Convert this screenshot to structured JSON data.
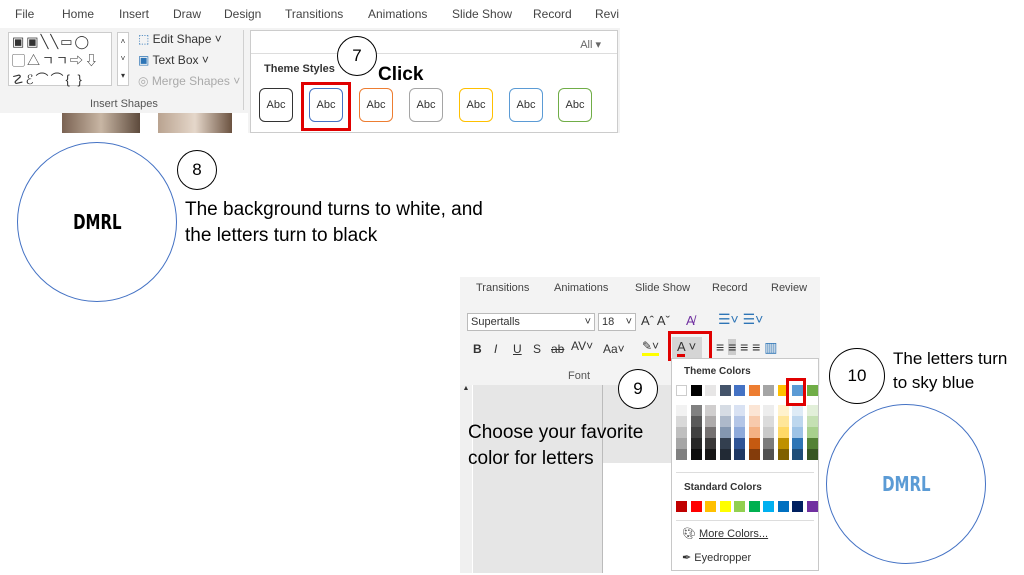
{
  "top_ribbon": {
    "tabs": [
      "File",
      "Home",
      "Insert",
      "Draw",
      "Design",
      "Transitions",
      "Animations",
      "Slide Show",
      "Record",
      "Revi"
    ],
    "shape_rows": [
      "▣▣╲╲▭◯",
      "▢△ㄱㄱ⇨⇩",
      "☡ℰ⌒⌒{ }"
    ],
    "edit_shape": "Edit Shape ˅",
    "text_box": "Text Box ˅",
    "merge_shapes": "Merge Shapes ˅",
    "group_label": "Insert Shapes",
    "all_dropdown": "All ▾",
    "theme_styles": "Theme Styles",
    "style_labels": [
      "Abc",
      "Abc",
      "Abc",
      "Abc",
      "Abc",
      "Abc",
      "Abc"
    ],
    "style_colors": [
      "#333333",
      "#4472c4",
      "#ed7d31",
      "#a5a5a5",
      "#ffc000",
      "#5b9bd5",
      "#70ad47"
    ]
  },
  "steps": {
    "s7": {
      "num": "7",
      "label": "Click"
    },
    "s8": {
      "num": "8",
      "text1": "The background turns to white, and",
      "text2": "the letters turn to black",
      "logo": "DMRL",
      "logo_color": "#000000"
    },
    "s9": {
      "num": "9",
      "text1": "Choose your favorite",
      "text2": "color for letters"
    },
    "s10": {
      "num": "10",
      "text1": "The letters turn",
      "text2": "to sky blue",
      "logo": "DMRL",
      "logo_color": "#5b9bd5"
    }
  },
  "font_ribbon": {
    "tabs": [
      "Transitions",
      "Animations",
      "Slide Show",
      "Record",
      "Review"
    ],
    "font_name": "Supertalls",
    "font_size": "18",
    "format_buttons": [
      "B",
      "I",
      "U",
      "S",
      "ab",
      "AV˅",
      "Aa˅"
    ],
    "group_label": "Font"
  },
  "color_menu": {
    "theme_title": "Theme Colors",
    "theme": [
      "#ffffff",
      "#000000",
      "#e7e6e6",
      "#44546a",
      "#4472c4",
      "#ed7d31",
      "#a5a5a5",
      "#ffc000",
      "#5b9bd5",
      "#70ad47"
    ],
    "shades": [
      [
        "#f2f2f2",
        "#d9d9d9",
        "#bfbfbf",
        "#a6a6a6",
        "#808080"
      ],
      [
        "#808080",
        "#595959",
        "#404040",
        "#262626",
        "#0d0d0d"
      ],
      [
        "#d0cece",
        "#aeabab",
        "#757171",
        "#3a3838",
        "#171616"
      ],
      [
        "#d6dce4",
        "#adb9ca",
        "#8497b0",
        "#333f4f",
        "#222a35"
      ],
      [
        "#d9e2f3",
        "#b4c6e7",
        "#8eaadb",
        "#2f5496",
        "#1f3864"
      ],
      [
        "#fbe5d5",
        "#f7caac",
        "#f4b183",
        "#c55a11",
        "#843c0b"
      ],
      [
        "#ededed",
        "#dbdbdb",
        "#c9c9c9",
        "#7b7b7b",
        "#525252"
      ],
      [
        "#fff2cc",
        "#ffe699",
        "#ffd966",
        "#bf9000",
        "#7f6000"
      ],
      [
        "#deebf6",
        "#bdd7ee",
        "#9dc3e6",
        "#2e75b5",
        "#1f4e79"
      ],
      [
        "#e2efd9",
        "#c5e0b3",
        "#a8d08d",
        "#538135",
        "#375623"
      ]
    ],
    "standard_title": "Standard Colors",
    "standard": [
      "#c00000",
      "#ff0000",
      "#ffc000",
      "#ffff00",
      "#92d050",
      "#00b050",
      "#00b0f0",
      "#0070c0",
      "#002060",
      "#7030a0"
    ],
    "more_colors": "More Colors...",
    "eyedropper": "Eyedropper"
  }
}
